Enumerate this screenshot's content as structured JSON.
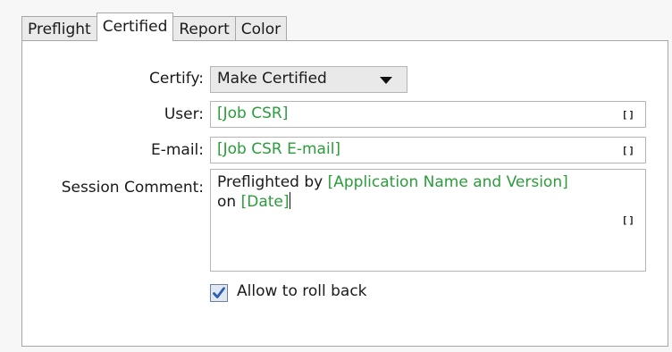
{
  "tabs": [
    {
      "label": "Preflight",
      "active": false
    },
    {
      "label": "Certified",
      "active": true
    },
    {
      "label": "Report",
      "active": false
    },
    {
      "label": "Color",
      "active": false
    }
  ],
  "certify": {
    "label": "Certify:",
    "selected": "Make Certified"
  },
  "user": {
    "label": "User:",
    "value": "[Job CSR]",
    "icon": "variable-insert-icon"
  },
  "email": {
    "label": "E-mail:",
    "value": "[Job CSR E-mail]",
    "icon": "variable-insert-icon"
  },
  "session_comment": {
    "label": "Session Comment:",
    "text_1": "Preflighted by ",
    "var_1": "[Application Name and Version]",
    "text_2": "on ",
    "var_2": "[Date]",
    "icon": "variable-insert-icon"
  },
  "rollback": {
    "label": "Allow to roll back",
    "checked": true
  },
  "variable_icon_glyph": "[]",
  "colors": {
    "variable_text": "#2a9d3a",
    "checkmark": "#2b5fb3"
  }
}
